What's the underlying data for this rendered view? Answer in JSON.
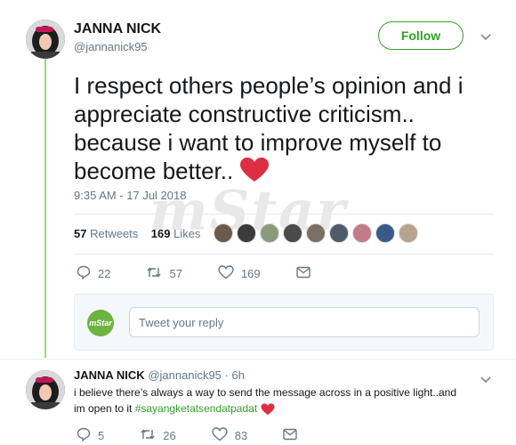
{
  "tweet": {
    "author_name": "JANNA NICK",
    "author_handle": "@jannanick95",
    "follow_label": "Follow",
    "text": "I respect others people’s opinion and i appreciate constructive criticism.. because i want to improve myself to become better..",
    "timestamp": "9:35 AM - 17 Jul 2018",
    "retweets_count": "57",
    "retweets_label": "Retweets",
    "likes_count": "169",
    "likes_label": "Likes",
    "actions": {
      "replies": "22",
      "retweets": "57",
      "likes": "169"
    }
  },
  "reply_box": {
    "brand": "mStar",
    "placeholder": "Tweet your reply"
  },
  "reply": {
    "author_name": "JANNA NICK",
    "author_handle": "@jannanick95",
    "time": "· 6h",
    "text_line1": "i believe there’s always a way to send the message across in a positive light..and",
    "text_line2": "im open to it ",
    "hashtag": "#sayangketatsendatpadat",
    "actions": {
      "replies": "5",
      "retweets": "26",
      "likes": "83"
    }
  },
  "watermark": "mStar",
  "colors": {
    "accent": "#35a02a",
    "heart": "#e0245e",
    "thread": "#8edf7c",
    "muted": "#657786"
  }
}
